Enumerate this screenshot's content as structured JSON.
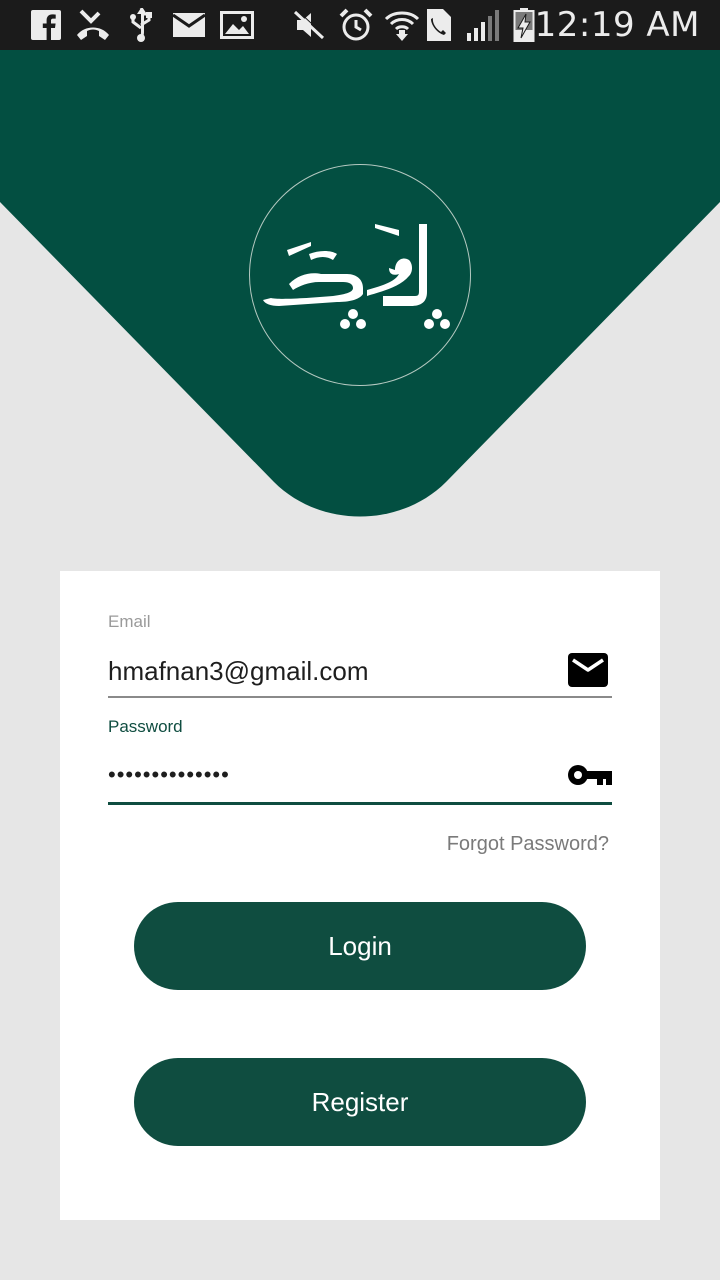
{
  "status_bar": {
    "time": "12:19 AM",
    "icons": [
      "facebook-icon",
      "missed-call-icon",
      "usb-icon",
      "email-notification-icon",
      "gallery-icon",
      "mute-icon",
      "alarm-icon",
      "wifi-icon",
      "call-icon",
      "signal-icon",
      "battery-charging-icon"
    ]
  },
  "header": {
    "logo_text": "پوکی",
    "brand_color": "#034f41"
  },
  "form": {
    "email_label": "Email",
    "email_value": "hmafnan3@gmail.com",
    "password_label": "Password",
    "password_masked": "••••••••••••••",
    "forgot_password": "Forgot Password?",
    "login_label": "Login",
    "register_label": "Register",
    "accent_color": "#0f4d40"
  }
}
